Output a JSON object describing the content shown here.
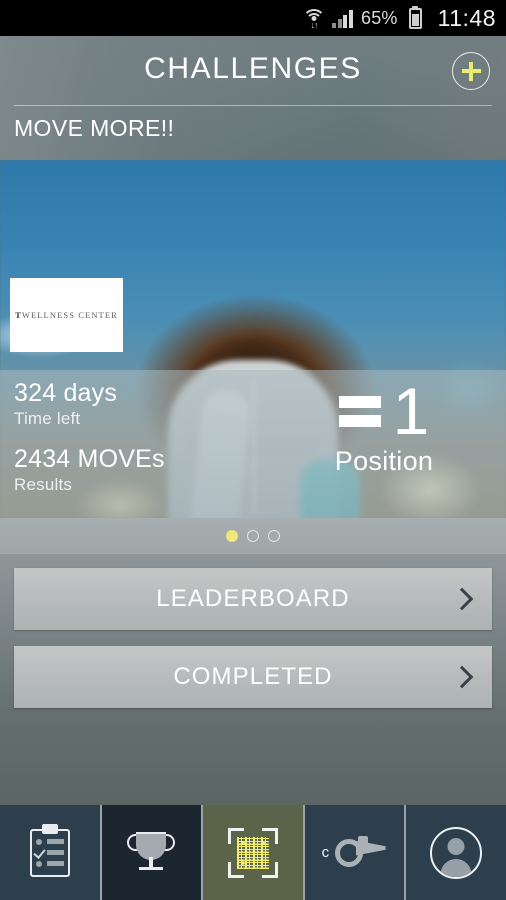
{
  "status_bar": {
    "wifi_icon": "wifi-icon",
    "signal_icon": "cellular-signal-icon",
    "battery_percent": "65%",
    "battery_icon": "battery-icon",
    "clock": "11:48"
  },
  "header": {
    "title": "CHALLENGES",
    "add_button_icon": "plus-icon",
    "subtitle": "MOVE MORE!!"
  },
  "hero": {
    "logo_text": "WELLNESS CENTER",
    "logo_mark": "T",
    "stats": {
      "time_value": "324 days",
      "time_label": "Time left",
      "results_value": "2434 MOVEs",
      "results_label": "Results",
      "position_value": "1",
      "position_label": "Position",
      "position_trend_icon": "equals-icon"
    }
  },
  "pager": {
    "total": 3,
    "active_index": 0,
    "active_color": "#f0e87a"
  },
  "list_buttons": [
    {
      "label": "LEADERBOARD",
      "chevron_icon": "chevron-right-icon"
    },
    {
      "label": "COMPLETED",
      "chevron_icon": "chevron-right-icon"
    }
  ],
  "bottom_nav": {
    "items": [
      {
        "name": "checklist",
        "icon": "clipboard-checklist-icon",
        "state": "normal"
      },
      {
        "name": "trophy",
        "icon": "trophy-icon",
        "state": "pressed"
      },
      {
        "name": "scan",
        "icon": "qr-code-scan-icon",
        "state": "active"
      },
      {
        "name": "coach",
        "icon": "whistle-icon",
        "label": "c",
        "state": "normal"
      },
      {
        "name": "profile",
        "icon": "user-avatar-icon",
        "state": "normal"
      }
    ],
    "active_bg": "#5b6449",
    "bg": "#2d3e4d"
  }
}
